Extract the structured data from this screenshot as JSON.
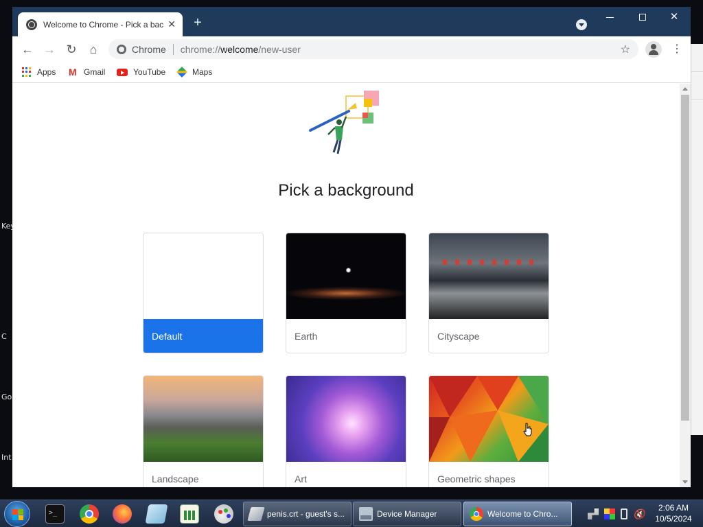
{
  "desktop": {
    "labels": [
      "Key",
      "C",
      "Go",
      "Int"
    ]
  },
  "browser": {
    "tab": {
      "title": "Welcome to Chrome - Pick a bac"
    },
    "omnibox": {
      "origin": "Chrome",
      "url_prefix": "chrome://",
      "url_host": "welcome",
      "url_path": "/new-user"
    },
    "bookmarks": [
      {
        "label": "Apps",
        "icon": "apps-grid-icon"
      },
      {
        "label": "Gmail",
        "icon": "gmail-icon"
      },
      {
        "label": "YouTube",
        "icon": "youtube-icon"
      },
      {
        "label": "Maps",
        "icon": "maps-icon"
      }
    ]
  },
  "page": {
    "heading": "Pick a background",
    "backgrounds": [
      {
        "label": "Default",
        "selected": true
      },
      {
        "label": "Earth",
        "selected": false
      },
      {
        "label": "Cityscape",
        "selected": false
      },
      {
        "label": "Landscape",
        "selected": false
      },
      {
        "label": "Art",
        "selected": false
      },
      {
        "label": "Geometric shapes",
        "selected": false
      }
    ]
  },
  "taskbar": {
    "pinned": [
      "command-prompt-icon",
      "chrome-icon",
      "firefox-icon",
      "notes-icon",
      "chart-icon",
      "paint-icon"
    ],
    "tasks": [
      {
        "label": "penis.crt - guest's s...",
        "icon": "file-icon",
        "active": false
      },
      {
        "label": "Device Manager",
        "icon": "device-manager-icon",
        "active": false
      },
      {
        "label": "Welcome to Chro...",
        "icon": "chrome-icon",
        "active": true
      }
    ],
    "clock": {
      "time": "2:06 AM",
      "date": "10/5/2024"
    }
  },
  "colors": {
    "titlebar": "#1f3a5a",
    "accent": "#1a73e8",
    "taskbar": "#1d2a40"
  }
}
